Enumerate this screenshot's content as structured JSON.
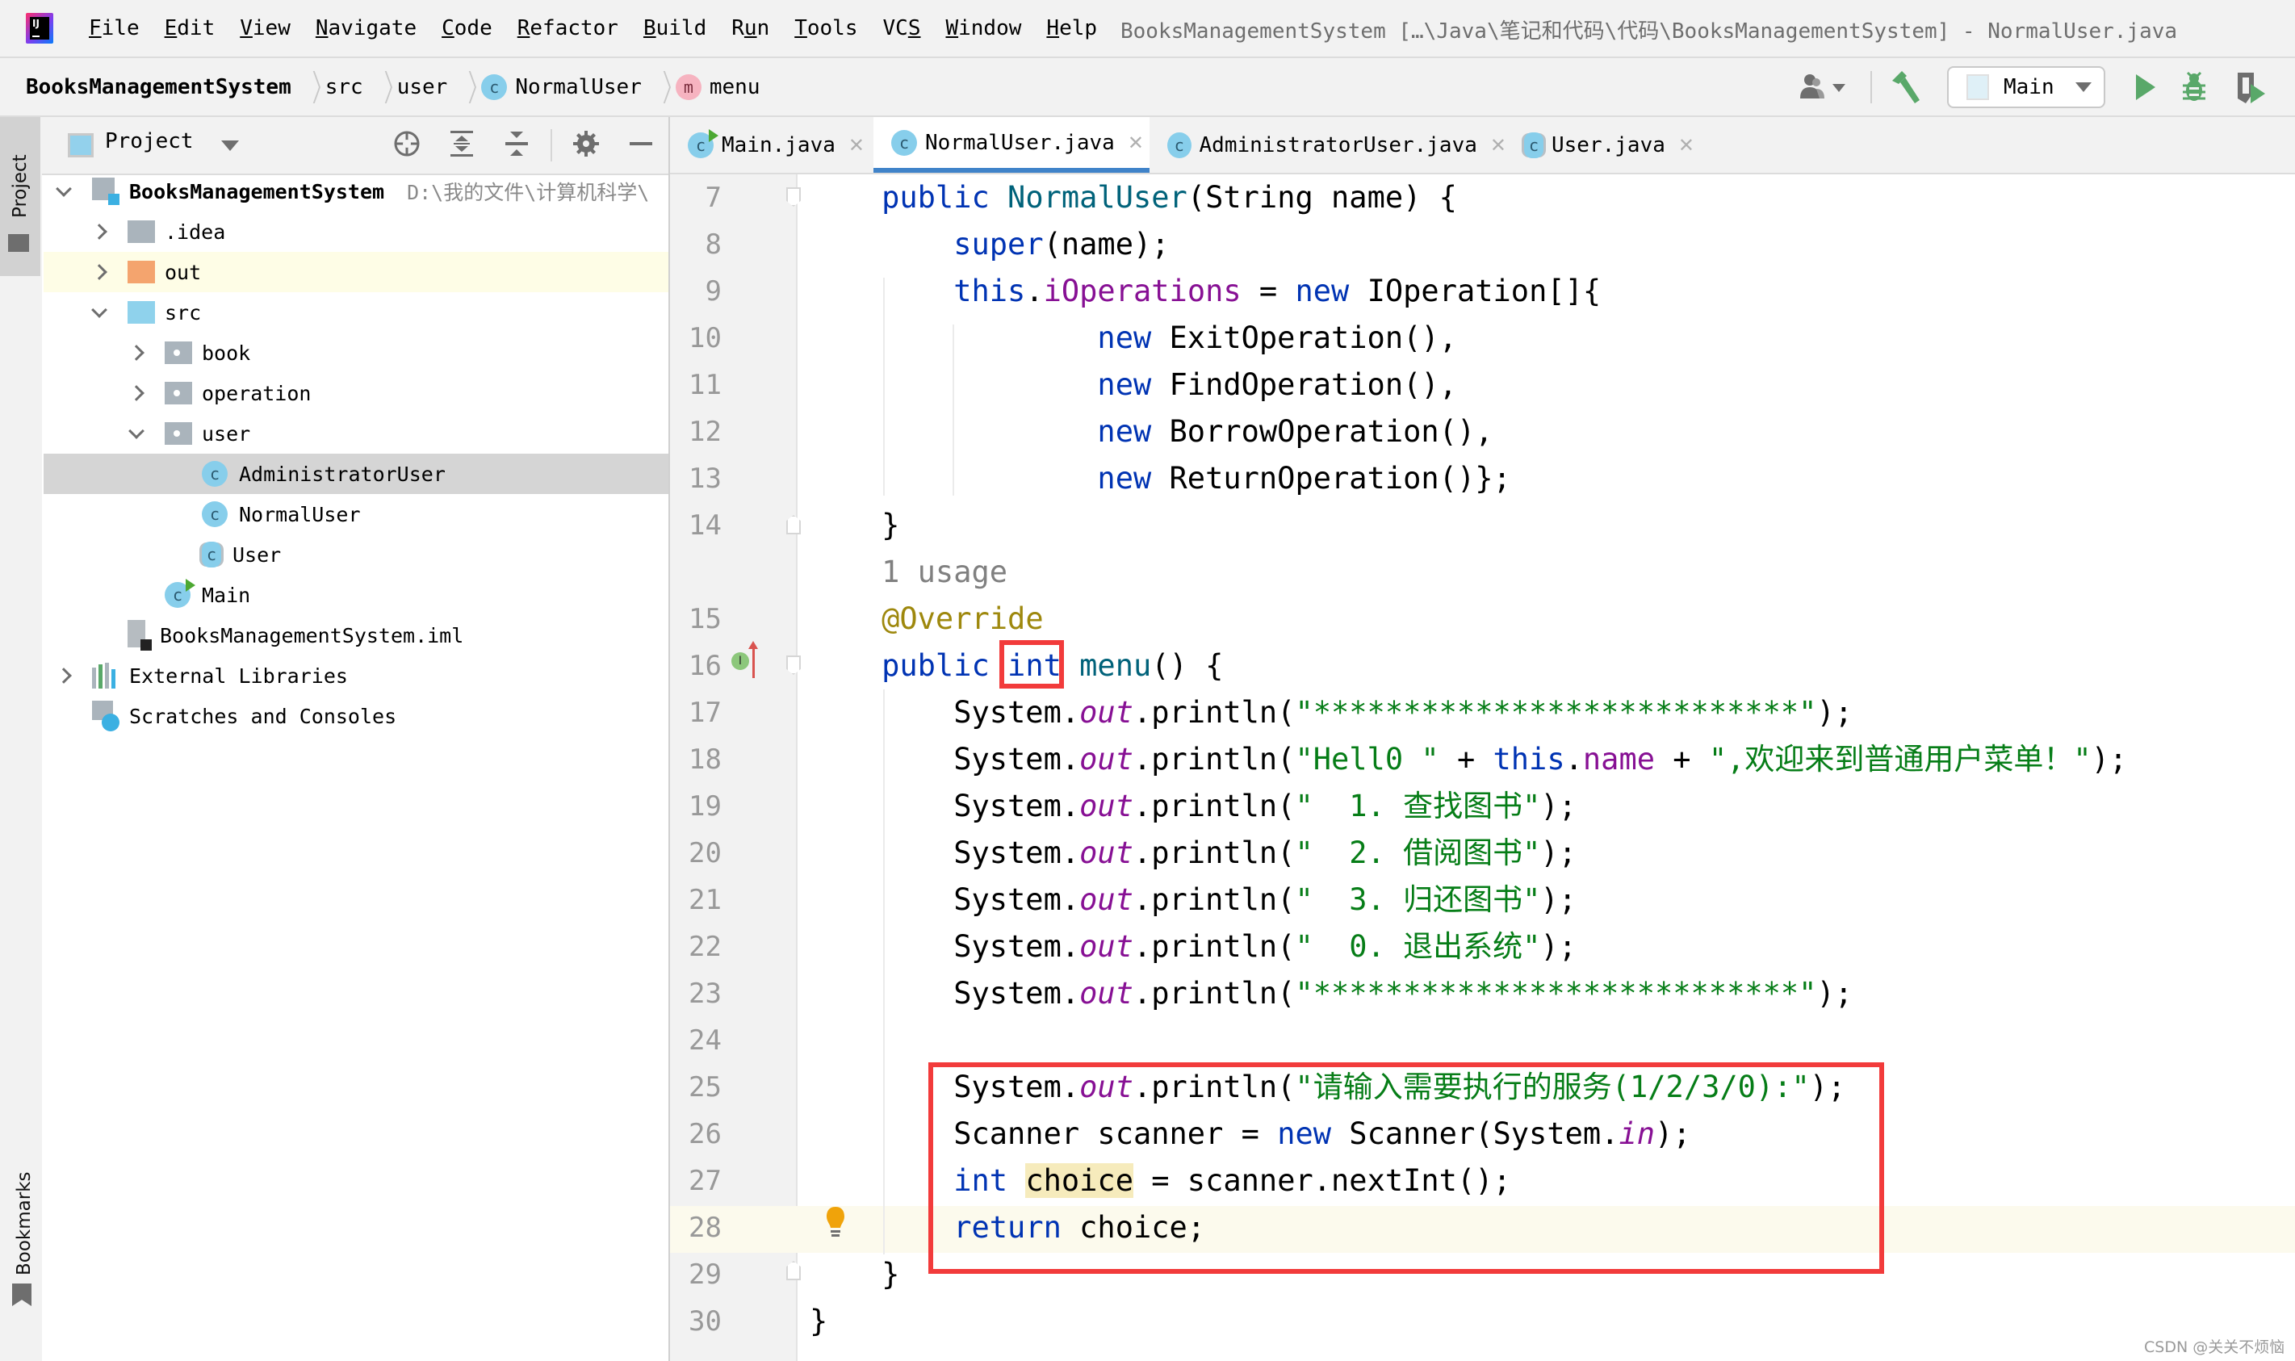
{
  "menubar": {
    "items": [
      {
        "label": "File",
        "mnemonic": "F",
        "rest": "ile"
      },
      {
        "label": "Edit",
        "mnemonic": "E",
        "rest": "dit"
      },
      {
        "label": "View",
        "mnemonic": "V",
        "rest": "iew"
      },
      {
        "label": "Navigate",
        "mnemonic": "N",
        "rest": "avigate"
      },
      {
        "label": "Code",
        "mnemonic": "C",
        "rest": "ode"
      },
      {
        "label": "Refactor",
        "mnemonic": "R",
        "rest": "efactor"
      },
      {
        "label": "Build",
        "mnemonic": "B",
        "rest": "uild"
      },
      {
        "label": "Run",
        "pre": "R",
        "mnemonic": "u",
        "rest": "n"
      },
      {
        "label": "Tools",
        "mnemonic": "T",
        "rest": "ools"
      },
      {
        "label": "VCS",
        "pre": "VC",
        "mnemonic": "S",
        "rest": ""
      },
      {
        "label": "Window",
        "mnemonic": "W",
        "rest": "indow"
      },
      {
        "label": "Help",
        "mnemonic": "H",
        "rest": "elp"
      }
    ],
    "window_title": "BooksManagementSystem […\\Java\\笔记和代码\\代码\\BooksManagementSystem] - NormalUser.java"
  },
  "breadcrumb": {
    "project": "BooksManagementSystem",
    "items": [
      "src",
      "user"
    ],
    "class_badge": "c",
    "class_name": "NormalUser",
    "method_badge": "m",
    "method_name": "menu"
  },
  "toolbar": {
    "run_config": "Main"
  },
  "left_stripe": {
    "project_label": "Project",
    "bookmarks_label": "Bookmarks"
  },
  "project_panel": {
    "title": "Project",
    "tree": [
      {
        "label": "BooksManagementSystem",
        "hint": "D:\\我的文件\\计算机科学\\",
        "type": "module",
        "expanded": true,
        "depth": 0
      },
      {
        "label": ".idea",
        "type": "folder",
        "expanded": false,
        "depth": 1
      },
      {
        "label": "out",
        "type": "folder-excluded",
        "expanded": false,
        "depth": 1,
        "highlighted": true
      },
      {
        "label": "src",
        "type": "folder-source",
        "expanded": true,
        "depth": 1
      },
      {
        "label": "book",
        "type": "package",
        "expanded": false,
        "depth": 2
      },
      {
        "label": "operation",
        "type": "package",
        "expanded": false,
        "depth": 2
      },
      {
        "label": "user",
        "type": "package",
        "expanded": true,
        "depth": 2
      },
      {
        "label": "AdministratorUser",
        "type": "class",
        "depth": 3,
        "selected": true
      },
      {
        "label": "NormalUser",
        "type": "class",
        "depth": 3
      },
      {
        "label": "User",
        "type": "abstract-class",
        "depth": 3
      },
      {
        "label": "Main",
        "type": "runnable-class",
        "depth": 2
      },
      {
        "label": "BooksManagementSystem.iml",
        "type": "iml",
        "depth": 1
      },
      {
        "label": "External Libraries",
        "type": "libraries",
        "expanded": false,
        "depth": 0
      },
      {
        "label": "Scratches and Consoles",
        "type": "scratches",
        "depth": 0
      }
    ]
  },
  "editor": {
    "tabs": [
      {
        "label": "Main.java",
        "icon": "runnable-class",
        "active": false
      },
      {
        "label": "NormalUser.java",
        "icon": "class",
        "active": true
      },
      {
        "label": "AdministratorUser.java",
        "icon": "class",
        "active": false
      },
      {
        "label": "User.java",
        "icon": "abstract-class",
        "active": false
      }
    ],
    "close_glyph": "✕",
    "usage_hint": "1 usage",
    "lines": [
      {
        "n": "7",
        "tokens": [
          [
            "",
            "    "
          ],
          [
            "kw",
            "public "
          ],
          [
            "fn",
            "NormalUser"
          ],
          [
            "",
            "(String name) {"
          ]
        ]
      },
      {
        "n": "8",
        "tokens": [
          [
            "",
            "        "
          ],
          [
            "kw",
            "super"
          ],
          [
            "",
            "(name);"
          ]
        ]
      },
      {
        "n": "9",
        "tokens": [
          [
            "",
            "        "
          ],
          [
            "kw",
            "this"
          ],
          [
            "",
            "."
          ],
          [
            "fld",
            "iOperations"
          ],
          [
            "",
            " = "
          ],
          [
            "kw",
            "new"
          ],
          [
            "",
            " IOperation[]{"
          ]
        ]
      },
      {
        "n": "10",
        "tokens": [
          [
            "",
            "                "
          ],
          [
            "kw",
            "new"
          ],
          [
            "",
            " ExitOperation(),"
          ]
        ]
      },
      {
        "n": "11",
        "tokens": [
          [
            "",
            "                "
          ],
          [
            "kw",
            "new"
          ],
          [
            "",
            " FindOperation(),"
          ]
        ]
      },
      {
        "n": "12",
        "tokens": [
          [
            "",
            "                "
          ],
          [
            "kw",
            "new"
          ],
          [
            "",
            " BorrowOperation(),"
          ]
        ]
      },
      {
        "n": "13",
        "tokens": [
          [
            "",
            "                "
          ],
          [
            "kw",
            "new"
          ],
          [
            "",
            " ReturnOperation()};"
          ]
        ]
      },
      {
        "n": "14",
        "tokens": [
          [
            "",
            "    }"
          ]
        ]
      },
      {
        "n": "",
        "tokens": [
          [
            "",
            "    "
          ],
          [
            "hint",
            "1 usage"
          ]
        ]
      },
      {
        "n": "15",
        "tokens": [
          [
            "",
            "    "
          ],
          [
            "ann",
            "@Override"
          ]
        ]
      },
      {
        "n": "16",
        "tokens": [
          [
            "",
            "    "
          ],
          [
            "kw",
            "public int "
          ],
          [
            "fn",
            "menu"
          ],
          [
            "",
            "() {"
          ]
        ]
      },
      {
        "n": "17",
        "tokens": [
          [
            "",
            "        System."
          ],
          [
            "st",
            "out"
          ],
          [
            "",
            ".println("
          ],
          [
            "str",
            "\"***************************\""
          ],
          [
            "",
            ");"
          ]
        ]
      },
      {
        "n": "18",
        "tokens": [
          [
            "",
            "        System."
          ],
          [
            "st",
            "out"
          ],
          [
            "",
            ".println("
          ],
          [
            "str",
            "\"Hell0 \""
          ],
          [
            "",
            " + "
          ],
          [
            "kw",
            "this"
          ],
          [
            "",
            "."
          ],
          [
            "fld",
            "name"
          ],
          [
            "",
            " + "
          ],
          [
            "str",
            "\",欢迎来到普通用户菜单！\""
          ],
          [
            "",
            ");"
          ]
        ]
      },
      {
        "n": "19",
        "tokens": [
          [
            "",
            "        System."
          ],
          [
            "st",
            "out"
          ],
          [
            "",
            ".println("
          ],
          [
            "str",
            "\"  1. 查找图书\""
          ],
          [
            "",
            ");"
          ]
        ]
      },
      {
        "n": "20",
        "tokens": [
          [
            "",
            "        System."
          ],
          [
            "st",
            "out"
          ],
          [
            "",
            ".println("
          ],
          [
            "str",
            "\"  2. 借阅图书\""
          ],
          [
            "",
            ");"
          ]
        ]
      },
      {
        "n": "21",
        "tokens": [
          [
            "",
            "        System."
          ],
          [
            "st",
            "out"
          ],
          [
            "",
            ".println("
          ],
          [
            "str",
            "\"  3. 归还图书\""
          ],
          [
            "",
            ");"
          ]
        ]
      },
      {
        "n": "22",
        "tokens": [
          [
            "",
            "        System."
          ],
          [
            "st",
            "out"
          ],
          [
            "",
            ".println("
          ],
          [
            "str",
            "\"  0. 退出系统\""
          ],
          [
            "",
            ");"
          ]
        ]
      },
      {
        "n": "23",
        "tokens": [
          [
            "",
            "        System."
          ],
          [
            "st",
            "out"
          ],
          [
            "",
            ".println("
          ],
          [
            "str",
            "\"***************************\""
          ],
          [
            "",
            ");"
          ]
        ]
      },
      {
        "n": "24",
        "tokens": []
      },
      {
        "n": "25",
        "tokens": [
          [
            "",
            "        System."
          ],
          [
            "st",
            "out"
          ],
          [
            "",
            ".println("
          ],
          [
            "str",
            "\"请输入需要执行的服务(1/2/3/0):\""
          ],
          [
            "",
            ");"
          ]
        ]
      },
      {
        "n": "26",
        "tokens": [
          [
            "",
            "        Scanner scanner = "
          ],
          [
            "kw",
            "new"
          ],
          [
            "",
            " Scanner(System."
          ],
          [
            "st",
            "in"
          ],
          [
            "",
            ");"
          ]
        ]
      },
      {
        "n": "27",
        "tokens": [
          [
            "",
            "        "
          ],
          [
            "kw",
            "int"
          ],
          [
            "",
            " "
          ],
          [
            "hl-var",
            "choice"
          ],
          [
            "",
            " = scanner.nextInt();"
          ]
        ]
      },
      {
        "n": "28",
        "tokens": [
          [
            "",
            "        "
          ],
          [
            "kw",
            "return"
          ],
          [
            "",
            " choice;"
          ]
        ]
      },
      {
        "n": "29",
        "tokens": [
          [
            "",
            "    }"
          ]
        ]
      },
      {
        "n": "30",
        "tokens": [
          [
            "",
            "}"
          ]
        ]
      }
    ],
    "current_line": "28",
    "annotations": {
      "highlight_int": "int",
      "highlight_block_lines": [
        "25",
        "26",
        "27",
        "28"
      ]
    },
    "gutter_override_badge": "I"
  },
  "watermark": "CSDN @关关不烦恼"
}
